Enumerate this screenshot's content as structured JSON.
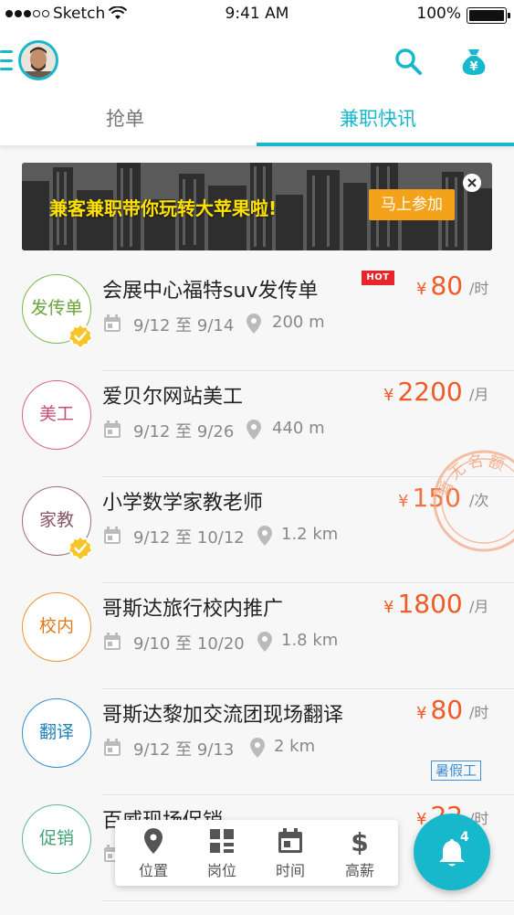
{
  "status_bar": {
    "carrier": "Sketch",
    "time": "9:41 AM",
    "battery": "100%"
  },
  "colors": {
    "accent": "#18b8cc",
    "price": "#f05a24",
    "banner_text": "#ffe100",
    "banner_button": "#f5a21b",
    "hot": "#e8262a"
  },
  "nav": {
    "left_icons": [
      "menu-icon",
      "avatar"
    ],
    "right_icons": [
      "search-icon",
      "money-bag-icon"
    ]
  },
  "tabs": [
    {
      "label": "抢单",
      "active": false
    },
    {
      "label": "兼职快讯",
      "active": true
    }
  ],
  "banner": {
    "text": "兼客兼职带你玩转大苹果啦!",
    "button": "马上参加"
  },
  "jobs": [
    {
      "category": "发传单",
      "title": "会展中心福特suv发传单",
      "hot": "HOT",
      "dates": "9/12 至 9/14",
      "distance": "200 m",
      "currency": "¥",
      "price": "80",
      "unit": "/时",
      "verified": true
    },
    {
      "category": "美工",
      "title": "爱贝尔网站美工",
      "dates": "9/12 至 9/26",
      "distance": "440 m",
      "currency": "¥",
      "price": "2200",
      "unit": "/月",
      "verified": false
    },
    {
      "category": "家教",
      "title": "小学数学家教老师",
      "dates": "9/12 至 10/12",
      "distance": "1.2 km",
      "currency": "¥",
      "price": "150",
      "unit": "/次",
      "verified": true,
      "stamp": "暂无名额"
    },
    {
      "category": "校内",
      "title": "哥斯达旅行校内推广",
      "dates": "9/10 至 10/20",
      "distance": "1.8 km",
      "currency": "¥",
      "price": "1800",
      "unit": "/月",
      "verified": false
    },
    {
      "category": "翻译",
      "title": "哥斯达黎加交流团现场翻译",
      "dates": "9/12 至 9/13",
      "distance": "2 km",
      "currency": "¥",
      "price": "80",
      "unit": "/时",
      "verified": false,
      "tag": "暑假工"
    },
    {
      "category": "促销",
      "title": "百威现场促销",
      "currency": "¥",
      "price": "22",
      "unit": "/时",
      "verified": false
    }
  ],
  "filter_bar": [
    {
      "label": "位置",
      "icon": "location-pin-icon"
    },
    {
      "label": "岗位",
      "icon": "grid-icon"
    },
    {
      "label": "时间",
      "icon": "calendar-icon"
    },
    {
      "label": "高薪",
      "icon": "dollar-icon"
    }
  ],
  "fab": {
    "icon": "bell-icon",
    "count": "4"
  }
}
